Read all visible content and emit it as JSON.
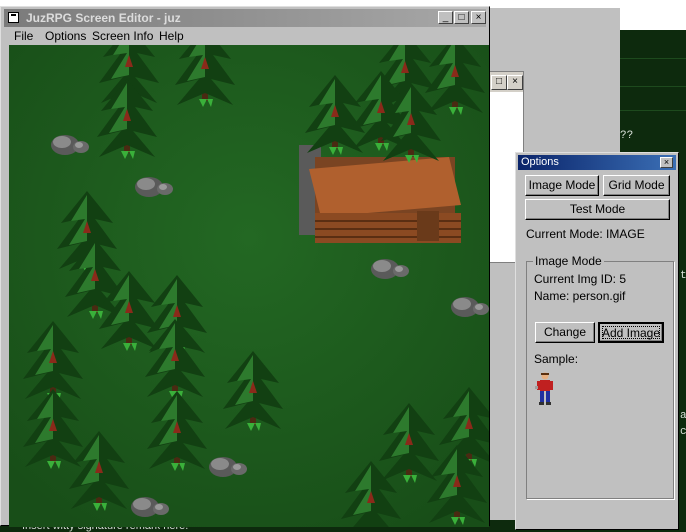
{
  "background": {
    "bottom_text": "Insert witty signature remark here.",
    "side_texts": [
      "??",
      "t",
      "a",
      "c"
    ]
  },
  "main_window": {
    "title": "JuzRPG Screen Editor - juz",
    "menu": [
      "File",
      "Options",
      "Screen Info",
      "Help"
    ],
    "controls": {
      "minimize": "_",
      "maximize": "□",
      "close": "×"
    }
  },
  "options_window": {
    "title": "Options",
    "close": "×",
    "buttons": {
      "image_mode": "Image Mode",
      "grid_mode": "Grid Mode",
      "test_mode": "Test Mode"
    },
    "current_mode": "Current Mode: IMAGE",
    "image_group": {
      "legend": "Image Mode",
      "current_img_id": "Current Img ID: 5",
      "name": "Name: person.gif",
      "change_label": "Change",
      "add_image_label": "Add Image",
      "sample_label": "Sample:"
    }
  },
  "icons": {
    "app": "app-window-icon",
    "sample": "person-sprite-icon"
  },
  "colors": {
    "grass": "#1c5a1c",
    "tree_dark": "#124012",
    "tree_light": "#2d7a2d",
    "cabin": "#a0522d",
    "rock": "#6e6e6e",
    "title_active": "#0a246a",
    "title_inactive": "#7b7b7b"
  }
}
